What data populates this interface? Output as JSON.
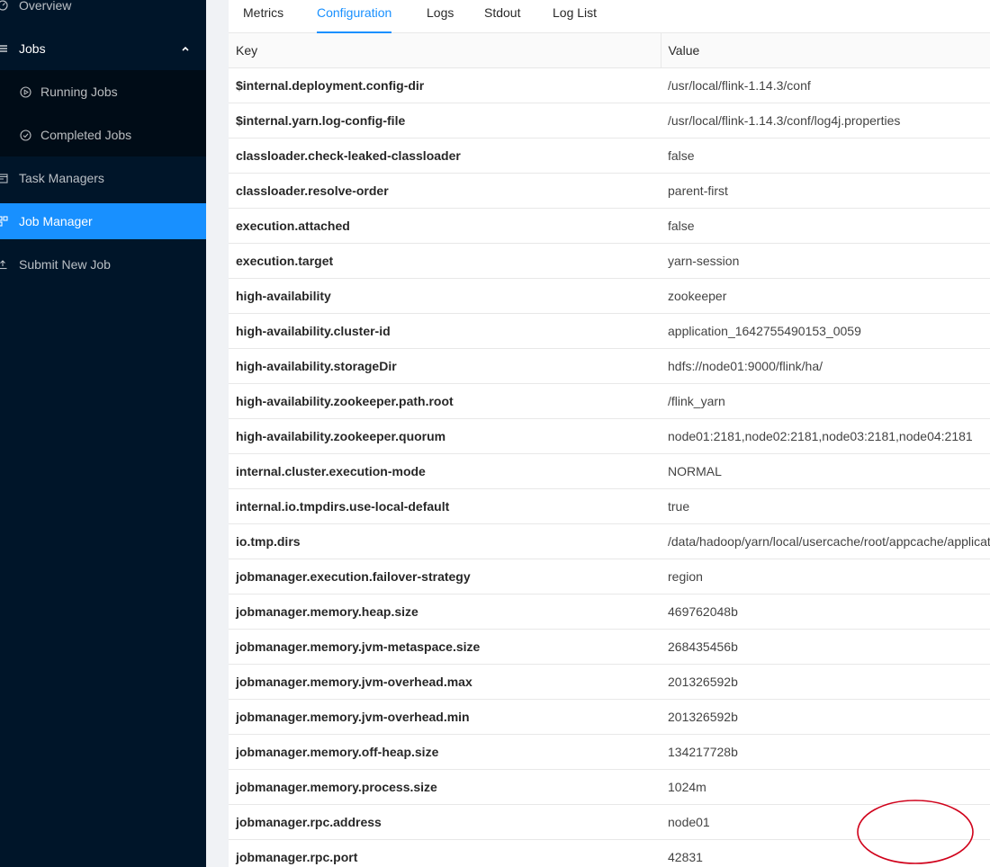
{
  "sidebar": {
    "overview": "Overview",
    "jobs": "Jobs",
    "running_jobs": "Running Jobs",
    "completed_jobs": "Completed Jobs",
    "task_managers": "Task Managers",
    "job_manager": "Job Manager",
    "submit_new_job": "Submit New Job"
  },
  "tabs": [
    "Metrics",
    "Configuration",
    "Logs",
    "Stdout",
    "Log List"
  ],
  "active_tab": "Configuration",
  "table": {
    "headers": {
      "key": "Key",
      "value": "Value"
    },
    "rows": [
      {
        "key": "$internal.deployment.config-dir",
        "value": "/usr/local/flink-1.14.3/conf"
      },
      {
        "key": "$internal.yarn.log-config-file",
        "value": "/usr/local/flink-1.14.3/conf/log4j.properties"
      },
      {
        "key": "classloader.check-leaked-classloader",
        "value": "false"
      },
      {
        "key": "classloader.resolve-order",
        "value": "parent-first"
      },
      {
        "key": "execution.attached",
        "value": "false"
      },
      {
        "key": "execution.target",
        "value": "yarn-session"
      },
      {
        "key": "high-availability",
        "value": "zookeeper"
      },
      {
        "key": "high-availability.cluster-id",
        "value": "application_1642755490153_0059"
      },
      {
        "key": "high-availability.storageDir",
        "value": "hdfs://node01:9000/flink/ha/"
      },
      {
        "key": "high-availability.zookeeper.path.root",
        "value": "/flink_yarn"
      },
      {
        "key": "high-availability.zookeeper.quorum",
        "value": "node01:2181,node02:2181,node03:2181,node04:2181"
      },
      {
        "key": "internal.cluster.execution-mode",
        "value": "NORMAL"
      },
      {
        "key": "internal.io.tmpdirs.use-local-default",
        "value": "true"
      },
      {
        "key": "io.tmp.dirs",
        "value": "/data/hadoop/yarn/local/usercache/root/appcache/application"
      },
      {
        "key": "jobmanager.execution.failover-strategy",
        "value": "region"
      },
      {
        "key": "jobmanager.memory.heap.size",
        "value": "469762048b"
      },
      {
        "key": "jobmanager.memory.jvm-metaspace.size",
        "value": "268435456b"
      },
      {
        "key": "jobmanager.memory.jvm-overhead.max",
        "value": "201326592b"
      },
      {
        "key": "jobmanager.memory.jvm-overhead.min",
        "value": "201326592b"
      },
      {
        "key": "jobmanager.memory.off-heap.size",
        "value": "134217728b"
      },
      {
        "key": "jobmanager.memory.process.size",
        "value": "1024m"
      },
      {
        "key": "jobmanager.rpc.address",
        "value": "node01"
      },
      {
        "key": "jobmanager.rpc.port",
        "value": "42831"
      }
    ]
  },
  "colors": {
    "sidebar_bg": "#001529",
    "submenu_bg": "#000c17",
    "accent": "#1890ff",
    "annotation": "#d0021b"
  },
  "icons": {
    "overview": "dashboard-icon",
    "jobs": "bars-icon",
    "running_jobs": "play-circle-icon",
    "completed_jobs": "check-circle-icon",
    "task_managers": "schedule-icon",
    "job_manager": "build-icon",
    "submit_new_job": "upload-icon",
    "jobs_toggle": "chevron-up-icon"
  }
}
